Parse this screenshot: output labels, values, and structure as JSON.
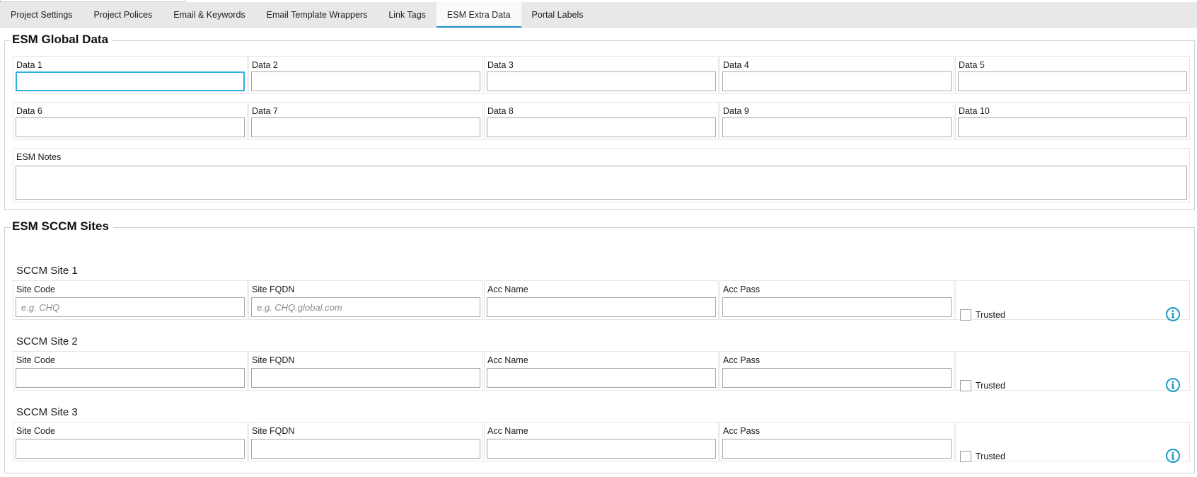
{
  "tabs": [
    {
      "label": "Project Settings",
      "active": false
    },
    {
      "label": "Project Polices",
      "active": false
    },
    {
      "label": "Email & Keywords",
      "active": false
    },
    {
      "label": "Email Template Wrappers",
      "active": false
    },
    {
      "label": "Link Tags",
      "active": false
    },
    {
      "label": "ESM Extra Data",
      "active": true
    },
    {
      "label": "Portal Labels",
      "active": false
    }
  ],
  "global": {
    "title": "ESM Global Data",
    "fields": [
      {
        "label": "Data 1",
        "value": ""
      },
      {
        "label": "Data 2",
        "value": ""
      },
      {
        "label": "Data 3",
        "value": ""
      },
      {
        "label": "Data 4",
        "value": ""
      },
      {
        "label": "Data 5",
        "value": ""
      },
      {
        "label": "Data 6",
        "value": ""
      },
      {
        "label": "Data 7",
        "value": ""
      },
      {
        "label": "Data 8",
        "value": ""
      },
      {
        "label": "Data 9",
        "value": ""
      },
      {
        "label": "Data 10",
        "value": ""
      }
    ],
    "notes": {
      "label": "ESM Notes",
      "value": ""
    }
  },
  "sccm": {
    "title": "ESM SCCM Sites",
    "sites": [
      {
        "title": "SCCM Site 1",
        "site_code": {
          "label": "Site Code",
          "placeholder": "e.g. CHQ"
        },
        "site_fqdn": {
          "label": "Site FQDN",
          "placeholder": "e.g. CHQ.global.com"
        },
        "acc_name": {
          "label": "Acc Name",
          "placeholder": ""
        },
        "acc_pass": {
          "label": "Acc Pass",
          "placeholder": ""
        },
        "trusted": {
          "label": "Trusted",
          "checked": false
        }
      },
      {
        "title": "SCCM Site 2",
        "site_code": {
          "label": "Site Code",
          "placeholder": ""
        },
        "site_fqdn": {
          "label": "Site FQDN",
          "placeholder": ""
        },
        "acc_name": {
          "label": "Acc Name",
          "placeholder": ""
        },
        "acc_pass": {
          "label": "Acc Pass",
          "placeholder": ""
        },
        "trusted": {
          "label": "Trusted",
          "checked": false
        }
      },
      {
        "title": "SCCM Site 3",
        "site_code": {
          "label": "Site Code",
          "placeholder": ""
        },
        "site_fqdn": {
          "label": "Site FQDN",
          "placeholder": ""
        },
        "acc_name": {
          "label": "Acc Name",
          "placeholder": ""
        },
        "acc_pass": {
          "label": "Acc Pass",
          "placeholder": ""
        },
        "trusted": {
          "label": "Trusted",
          "checked": false
        }
      }
    ]
  },
  "colors": {
    "accent": "#1b8dc4",
    "focus": "#31b0e0",
    "info_icon": "#1a9bc4"
  },
  "icons": {
    "trusted_info": "info-circle-icon"
  }
}
